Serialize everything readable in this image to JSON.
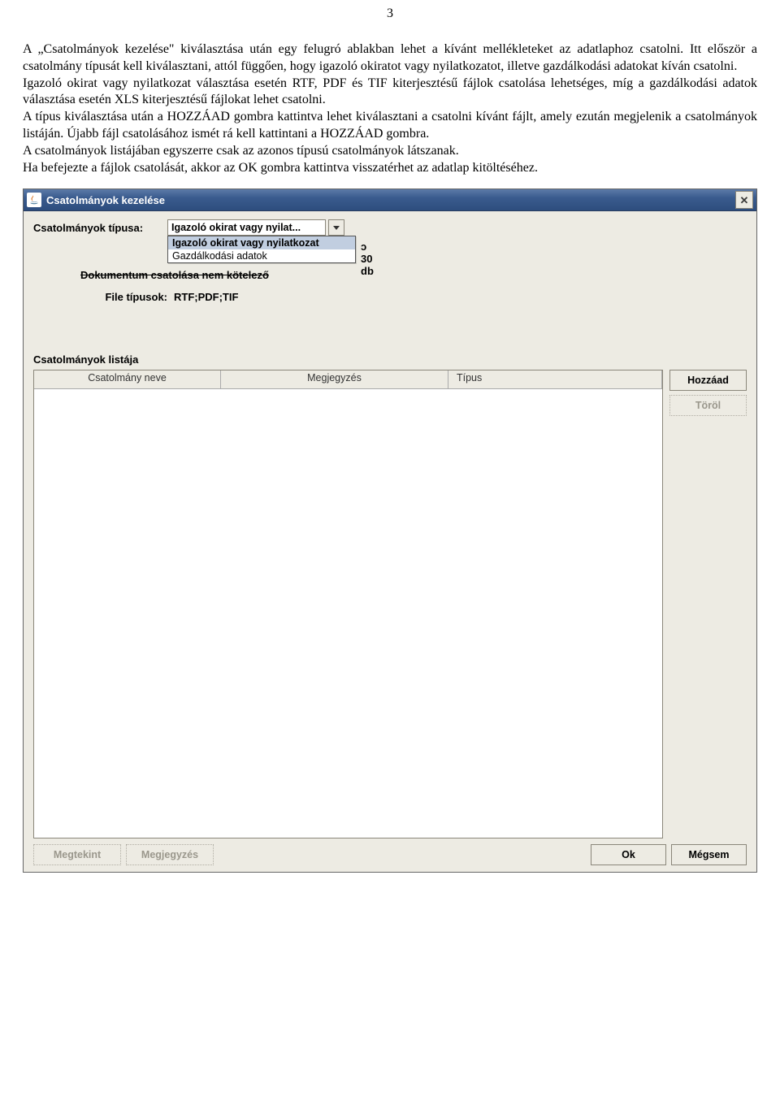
{
  "page_number": "3",
  "doc": {
    "p1": "A „Csatolmányok kezelése\" kiválasztása után egy felugró ablakban lehet a kívánt mellékleteket az adatlaphoz csatolni. Itt először a csatolmány típusát kell kiválasztani, attól függően, hogy igazoló okiratot vagy nyilatkozatot, illetve gazdálkodási adatokat kíván csatolni.",
    "p2": "Igazoló okirat vagy nyilatkozat választása esetén RTF, PDF és TIF kiterjesztésű fájlok csatolása lehetséges, míg a gazdálkodási adatok választása esetén XLS kiterjesztésű fájlokat lehet csatolni.",
    "p3": "A típus kiválasztása után a HOZZÁAD gombra kattintva lehet kiválasztani a csatolni kívánt fájlt, amely ezután megjelenik a csatolmányok listáján. Újabb fájl csatolásához ismét rá kell kattintani a HOZZÁAD gombra.",
    "p4": "A csatolmányok listájában egyszerre csak az azonos típusú csatolmányok látszanak.",
    "p5": "Ha befejezte a fájlok csatolását, akkor az OK gombra kattintva visszatérhet az adatlap kitöltéséhez."
  },
  "dialog": {
    "title": "Csatolmányok kezelése",
    "type_label": "Csatolmányok típusa:",
    "combo_value": "Igazoló okirat vagy nyilat...",
    "dropdown": {
      "opt1": "Igazoló okirat vagy nyilatkozat",
      "opt2": "Gazdálkodási adatok"
    },
    "peek_text": "ɔ 30 db",
    "underlay_text": "Dokumentum csatolása nem kötelező",
    "file_types_label": "File típusok:",
    "file_types_value": "RTF;PDF;TIF",
    "list_label": "Csatolmányok listája",
    "columns": {
      "name": "Csatolmány neve",
      "note": "Megjegyzés",
      "type": "Típus"
    },
    "buttons": {
      "add": "Hozzáad",
      "delete": "Töröl",
      "view": "Megtekint",
      "note": "Megjegyzés",
      "ok": "Ok",
      "cancel": "Mégsem"
    }
  }
}
